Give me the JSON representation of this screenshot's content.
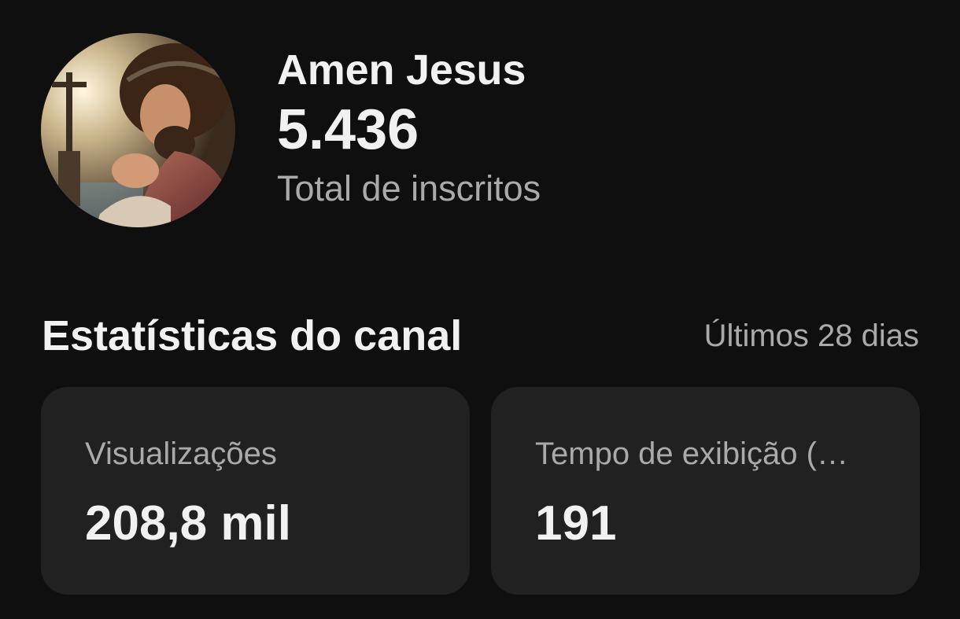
{
  "channel": {
    "name": "Amen Jesus",
    "subscriber_count": "5.436",
    "subscriber_label": "Total de inscritos",
    "avatar_icon": "channel-avatar-praying-figure-icon"
  },
  "stats": {
    "title": "Estatísticas do canal",
    "period": "Últimos 28 dias",
    "cards": [
      {
        "label": "Visualizações",
        "value": "208,8 mil"
      },
      {
        "label": "Tempo de exibição (…",
        "value": "191"
      }
    ]
  },
  "colors": {
    "background": "#0f0f0f",
    "card_background": "#212121",
    "primary_text": "#f1f1f1",
    "secondary_text": "#aaaaaa"
  }
}
